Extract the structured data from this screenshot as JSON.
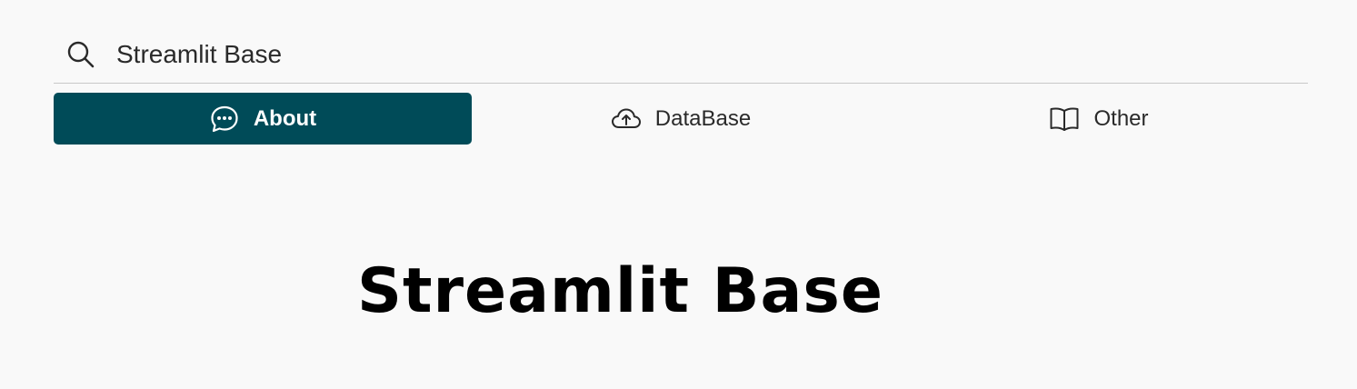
{
  "menu": {
    "title": "Streamlit Base",
    "title_icon": "search-icon",
    "tabs": [
      {
        "label": "About",
        "icon": "chat-dots-icon",
        "active": true
      },
      {
        "label": "DataBase",
        "icon": "cloud-upload-icon",
        "active": false
      },
      {
        "label": "Other",
        "icon": "book-icon",
        "active": false
      }
    ]
  },
  "main": {
    "title": "Streamlit Base"
  },
  "colors": {
    "active_tab": "#004b58",
    "background": "#f9f9f9"
  }
}
